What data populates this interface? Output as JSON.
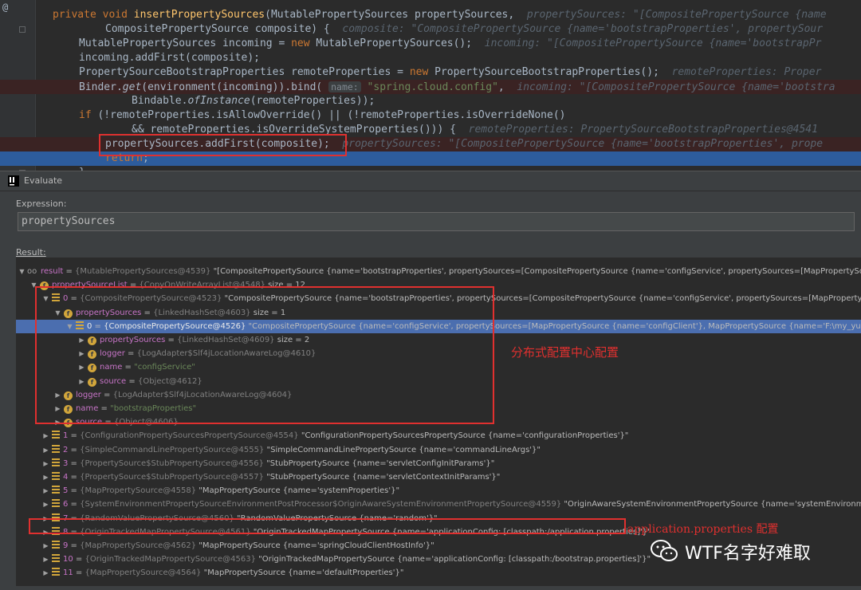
{
  "editor": {
    "lines": [
      {
        "segs": [
          [
            "kw",
            "private void "
          ],
          [
            "fn",
            "insertPropertySources"
          ],
          [
            "",
            "(MutablePropertySources propertySources,  "
          ],
          [
            "hint",
            "propertySources: \"[CompositePropertySource {name"
          ]
        ]
      },
      {
        "segs": [
          [
            "",
            "CompositePropertySource composite) {  "
          ],
          [
            "hint",
            "composite: \"CompositePropertySource {name='bootstrapProperties', propertySour"
          ]
        ]
      },
      {
        "segs": [
          [
            "",
            "MutablePropertySources incoming = "
          ],
          [
            "kw",
            "new "
          ],
          [
            "",
            "MutablePropertySources();  "
          ],
          [
            "hint",
            "incoming: \"[CompositePropertySource {name='bootstrapPr"
          ]
        ]
      },
      {
        "segs": [
          [
            "",
            "incoming.addFirst(composite);"
          ]
        ]
      },
      {
        "segs": [
          [
            "",
            "PropertySourceBootstrapProperties remoteProperties = "
          ],
          [
            "kw",
            "new "
          ],
          [
            "",
            "PropertySourceBootstrapProperties();  "
          ],
          [
            "hint",
            "remoteProperties: Proper"
          ]
        ]
      },
      {
        "segs": [
          [
            "",
            "Binder."
          ],
          [
            "it",
            "get"
          ],
          [
            "",
            "(environment(incoming)).bind( "
          ],
          [
            "ph",
            "name:"
          ],
          [
            "str",
            " \"spring.cloud.config\""
          ],
          [
            "",
            ",  "
          ],
          [
            "hint",
            "incoming: \"[CompositePropertySource {name='bootstra"
          ]
        ]
      },
      {
        "segs": [
          [
            "",
            "Bindable."
          ],
          [
            "it",
            "ofInstance"
          ],
          [
            "",
            "(remoteProperties));"
          ]
        ]
      },
      {
        "segs": [
          [
            "kw",
            "if "
          ],
          [
            "",
            "(!remoteProperties.isAllowOverride() || (!remoteProperties.isOverrideNone()"
          ]
        ]
      },
      {
        "segs": [
          [
            "",
            "&& remoteProperties.isOverrideSystemProperties())) {  "
          ],
          [
            "hint",
            "remoteProperties: PropertySourceBootstrapProperties@4541"
          ]
        ]
      },
      {
        "segs": [
          [
            "",
            "propertySources.addFirst(composite);  "
          ],
          [
            "hint",
            "propertySources: \"[CompositePropertySource {name='bootstrapProperties', prope"
          ]
        ]
      },
      {
        "segs": [
          [
            "kw",
            "return"
          ],
          [
            "",
            ";"
          ]
        ]
      },
      {
        "segs": [
          [
            "",
            "}"
          ]
        ]
      }
    ]
  },
  "dialog": {
    "title": "Evaluate",
    "expression_label": "Expression:",
    "expression_value": "propertySources",
    "result_label": "Result:"
  },
  "tree": [
    {
      "d": 0,
      "arrow": "open",
      "icon": "oo",
      "name": "result",
      "type": "{MutablePropertySources@4539}",
      "val": "\"[CompositePropertySource {name='bootstrapProperties', propertySources=[CompositePropertySource {name='configService', propertySources=[MapPropertySource {nam"
    },
    {
      "d": 1,
      "arrow": "open",
      "icon": "f",
      "name": "propertySourceList",
      "type": "{CopyOnWriteArrayList@4548}",
      "val": " size = 12"
    },
    {
      "d": 2,
      "arrow": "open",
      "icon": "a",
      "name": "0",
      "type": "{CompositePropertySource@4523}",
      "val": "\"CompositePropertySource {name='bootstrapProperties', propertySources=[CompositePropertySource {name='configService', propertySources=[MapPropertySource {n"
    },
    {
      "d": 3,
      "arrow": "open",
      "icon": "f",
      "name": "propertySources",
      "type": "{LinkedHashSet@4603}",
      "val": " size = 1"
    },
    {
      "d": 4,
      "arrow": "open",
      "icon": "a",
      "name": "0",
      "type": "{CompositePropertySource@4526}",
      "val": "\"CompositePropertySource {name='configService', propertySources=[MapPropertySource {name='configClient'}, MapPropertySource {name='F:\\my_yun_project\\co",
      "sel": true
    },
    {
      "d": 5,
      "arrow": "closed",
      "icon": "f",
      "name": "propertySources",
      "type": "{LinkedHashSet@4609}",
      "val": " size = 2"
    },
    {
      "d": 5,
      "arrow": "closed",
      "icon": "f",
      "name": "logger",
      "type": "{LogAdapter$Slf4jLocationAwareLog@4610}",
      "val": ""
    },
    {
      "d": 5,
      "arrow": "closed",
      "icon": "f",
      "name": "name",
      "type": "",
      "val": "",
      "str": "\"configService\""
    },
    {
      "d": 5,
      "arrow": "closed",
      "icon": "f",
      "name": "source",
      "type": "{Object@4612}",
      "val": ""
    },
    {
      "d": 3,
      "arrow": "closed",
      "icon": "f",
      "name": "logger",
      "type": "{LogAdapter$Slf4jLocationAwareLog@4604}",
      "val": ""
    },
    {
      "d": 3,
      "arrow": "closed",
      "icon": "f",
      "name": "name",
      "type": "",
      "val": "",
      "str": "\"bootstrapProperties\""
    },
    {
      "d": 3,
      "arrow": "closed",
      "icon": "f",
      "name": "source",
      "type": "{Object@4606}",
      "val": ""
    },
    {
      "d": 2,
      "arrow": "closed",
      "icon": "a",
      "name": "1",
      "type": "{ConfigurationPropertySourcesPropertySource@4554}",
      "val": "\"ConfigurationPropertySourcesPropertySource {name='configurationProperties'}\""
    },
    {
      "d": 2,
      "arrow": "closed",
      "icon": "a",
      "name": "2",
      "type": "{SimpleCommandLinePropertySource@4555}",
      "val": "\"SimpleCommandLinePropertySource {name='commandLineArgs'}\""
    },
    {
      "d": 2,
      "arrow": "closed",
      "icon": "a",
      "name": "3",
      "type": "{PropertySource$StubPropertySource@4556}",
      "val": "\"StubPropertySource {name='servletConfigInitParams'}\""
    },
    {
      "d": 2,
      "arrow": "closed",
      "icon": "a",
      "name": "4",
      "type": "{PropertySource$StubPropertySource@4557}",
      "val": "\"StubPropertySource {name='servletContextInitParams'}\""
    },
    {
      "d": 2,
      "arrow": "closed",
      "icon": "a",
      "name": "5",
      "type": "{MapPropertySource@4558}",
      "val": "\"MapPropertySource {name='systemProperties'}\""
    },
    {
      "d": 2,
      "arrow": "closed",
      "icon": "a",
      "name": "6",
      "type": "{SystemEnvironmentPropertySourceEnvironmentPostProcessor$OriginAwareSystemEnvironmentPropertySource@4559}",
      "val": "\"OriginAwareSystemEnvironmentPropertySource {name='systemEnvironment'}\""
    },
    {
      "d": 2,
      "arrow": "closed",
      "icon": "a",
      "name": "7",
      "type": "{RandomValuePropertySource@4560}",
      "val": "\"RandomValuePropertySource {name='random'}\""
    },
    {
      "d": 2,
      "arrow": "closed",
      "icon": "a",
      "name": "8",
      "type": "{OriginTrackedMapPropertySource@4561}",
      "val": "\"OriginTrackedMapPropertySource {name='applicationConfig: [classpath:/application.properties]'}\""
    },
    {
      "d": 2,
      "arrow": "closed",
      "icon": "a",
      "name": "9",
      "type": "{MapPropertySource@4562}",
      "val": "\"MapPropertySource {name='springCloudClientHostInfo'}\""
    },
    {
      "d": 2,
      "arrow": "closed",
      "icon": "a",
      "name": "10",
      "type": "{OriginTrackedMapPropertySource@4563}",
      "val": "\"OriginTrackedMapPropertySource {name='applicationConfig: [classpath:/bootstrap.properties]'}\""
    },
    {
      "d": 2,
      "arrow": "closed",
      "icon": "a",
      "name": "11",
      "type": "{MapPropertySource@4564}",
      "val": "\"MapPropertySource {name='defaultProperties'}\""
    }
  ],
  "annotations": {
    "distributed_config_label": "分布式配置中心配置",
    "application_properties_label": "application.properties 配置"
  },
  "watermark": {
    "text": "WTF名字好难取",
    "icon": "wechat-icon"
  },
  "colors": {
    "annotation_red": "#e0302f",
    "selection_blue": "#4b6eaf",
    "editor_bg": "#2b2b2b"
  }
}
